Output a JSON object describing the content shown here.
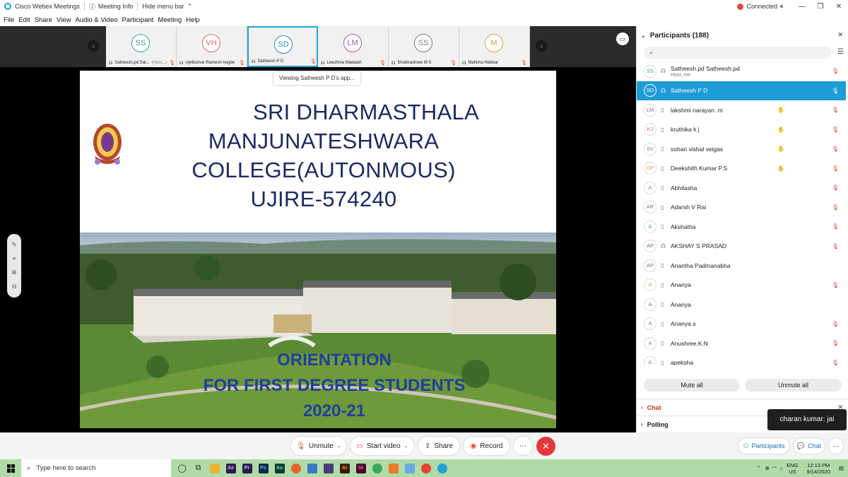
{
  "window": {
    "title": "Cisco Webex Meetings",
    "meeting_info": "Meeting Info",
    "hide_menu_bar": "Hide menu bar",
    "connection_status": "Connected"
  },
  "menu": [
    "File",
    "Edit",
    "Share",
    "View",
    "Audio & Video",
    "Participant",
    "Meeting",
    "Help"
  ],
  "filmstrip": [
    {
      "initials": "SS",
      "name": "Satheesh.pd Sat...",
      "tag": "(Host...)",
      "color": "#3aa0a0"
    },
    {
      "initials": "VH",
      "name": "vijetkumar Ramesh hegde",
      "tag": "",
      "color": "#e06a5a"
    },
    {
      "initials": "SD",
      "name": "Satheesh P D",
      "tag": "",
      "color": "#2a8ab8"
    },
    {
      "initials": "LM",
      "name": "Leeshma Madaiah",
      "tag": "",
      "color": "#9b59b6"
    },
    {
      "initials": "SS",
      "name": "Shubhashree M S",
      "tag": "",
      "color": "#7a7a7a"
    },
    {
      "initials": "M",
      "name": "Mahima Hebbar",
      "tag": "",
      "color": "#e0a13a"
    }
  ],
  "share": {
    "viewing_label": "Viewing Satheesh P D's app...",
    "title_lines": [
      "SRI DHARMASTHALA",
      "MANJUNATESHWARA",
      "COLLEGE(AUTONMOUS)",
      "UJIRE-574240"
    ],
    "orientation_lines": [
      "ORIENTATION",
      "FOR FIRST DEGREE STUDENTS",
      "2020-21"
    ]
  },
  "participants": {
    "header": "Participants (188)",
    "list": [
      {
        "initials": "SS",
        "name": "Satheesh.pd Satheesh.pd",
        "sub": "Host, me",
        "color": "#3aa0a0",
        "hand": false
      },
      {
        "initials": "SD",
        "name": "Satheesh P D",
        "sub": "",
        "color": "#2a8ab8",
        "hand": false
      },
      {
        "initials": "LM",
        "name": "lakshmi narayan. m",
        "sub": "",
        "color": "#9b59b6",
        "hand": true
      },
      {
        "initials": "KJ",
        "name": "kruthika k j",
        "sub": "",
        "color": "#e06a5a",
        "hand": true
      },
      {
        "initials": "SV",
        "name": "sohan vishal veigas",
        "sub": "",
        "color": "#7a7a7a",
        "hand": true
      },
      {
        "initials": "DP",
        "name": "Deekshith Kumar P.S",
        "sub": "",
        "color": "#e0a13a",
        "hand": true
      },
      {
        "initials": "A",
        "name": "Abhilasha",
        "sub": "",
        "color": "#e06a5a",
        "hand": false
      },
      {
        "initials": "AR",
        "name": "Adarsh V Rai",
        "sub": "",
        "color": "#7a7a7a",
        "hand": false
      },
      {
        "initials": "A",
        "name": "Akshatha",
        "sub": "",
        "color": "#3aa0a0",
        "hand": false
      },
      {
        "initials": "AP",
        "name": "AKSHAY S PRASAD",
        "sub": "",
        "color": "#9b59b6",
        "hand": false
      },
      {
        "initials": "AP",
        "name": "Anantha Padmanabha",
        "sub": "",
        "color": "#9b59b6",
        "hand": false
      },
      {
        "initials": "A",
        "name": "Ananya",
        "sub": "",
        "color": "#e0a13a",
        "hand": false
      },
      {
        "initials": "A",
        "name": "Ananya",
        "sub": "",
        "color": "#7a7a7a",
        "hand": false
      },
      {
        "initials": "A",
        "name": "Ananya.s",
        "sub": "",
        "color": "#3aa757",
        "hand": false
      },
      {
        "initials": "A",
        "name": "Anushree.K.N",
        "sub": "",
        "color": "#e06a5a",
        "hand": false
      },
      {
        "initials": "A",
        "name": "apeksha",
        "sub": "",
        "color": "#e06a5a",
        "hand": false
      }
    ],
    "mute_all": "Mute all",
    "unmute_all": "Unmute all"
  },
  "sections": {
    "chat": "Chat",
    "polling": "Polling"
  },
  "tooltip": "charan kumar: jai",
  "controls": {
    "unmute": "Unmute",
    "start_video": "Start video",
    "share": "Share",
    "record": "Record",
    "participants": "Participants",
    "chat": "Chat"
  },
  "taskbar": {
    "search_placeholder": "Type here to search",
    "lang_top": "ENG",
    "lang_bottom": "US",
    "time": "12:13 PM",
    "date": "9/14/2020"
  },
  "colors": {
    "accent": "#1d9cd8",
    "end": "#e5383b",
    "taskbar": "#b0dba8"
  }
}
